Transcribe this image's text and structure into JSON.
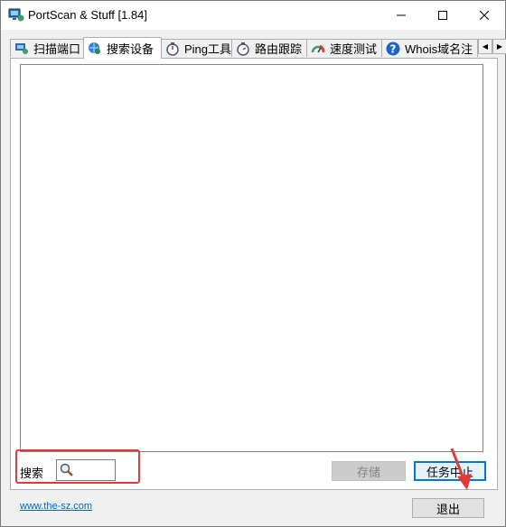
{
  "window": {
    "title": "PortScan & Stuff [1.84]"
  },
  "tabs": [
    {
      "label": "扫描端口",
      "icon": "network-monitor-icon"
    },
    {
      "label": "搜索设备",
      "icon": "globe-search-icon",
      "active": true
    },
    {
      "label": "Ping工具",
      "icon": "stopwatch-icon"
    },
    {
      "label": "路由跟踪",
      "icon": "stopwatch-icon"
    },
    {
      "label": "速度测试",
      "icon": "speedometer-icon"
    },
    {
      "label": "Whois域名注",
      "icon": "help-icon"
    }
  ],
  "search": {
    "label": "搜索",
    "value": ""
  },
  "buttons": {
    "save": "存储",
    "stop": "任务中止",
    "exit": "退出"
  },
  "footer": {
    "link": "www.the-sz.com"
  },
  "colors": {
    "highlight": "#e53935",
    "focus": "#0078d7",
    "link": "#0066cc"
  }
}
